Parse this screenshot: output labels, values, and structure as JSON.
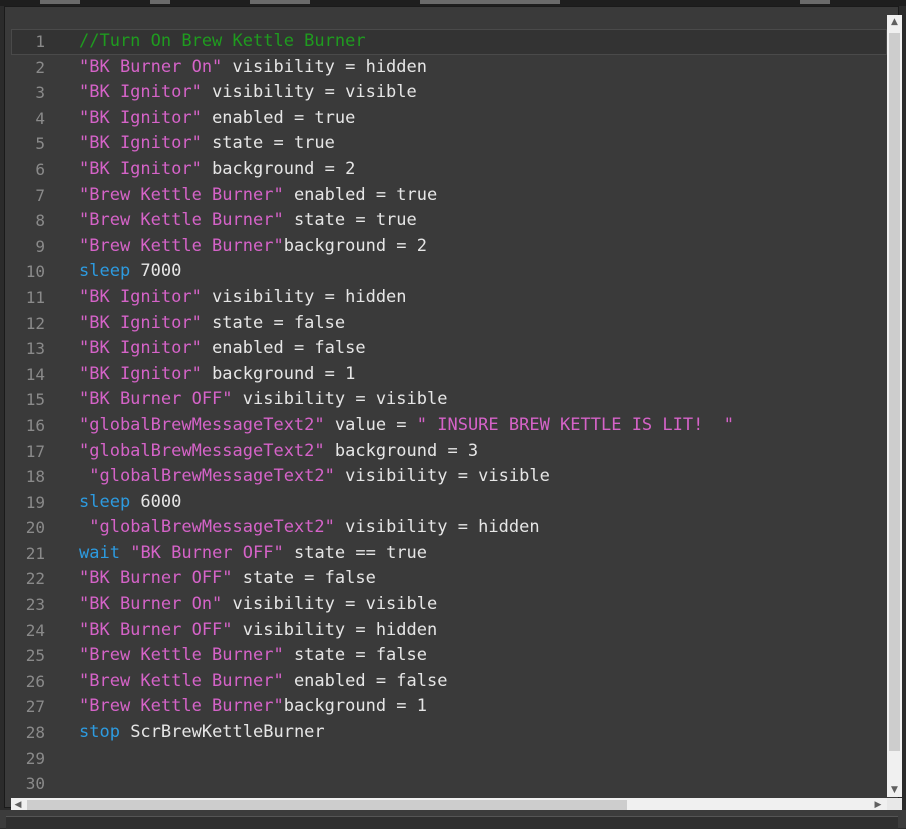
{
  "editor": {
    "lines": [
      {
        "n": "1",
        "tokens": [
          {
            "t": "cmt",
            "v": "//Turn On Brew Kettle Burner"
          }
        ]
      },
      {
        "n": "2",
        "tokens": [
          {
            "t": "str",
            "v": "\"BK Burner On\""
          },
          {
            "t": "txt",
            "v": " visibility = hidden"
          }
        ]
      },
      {
        "n": "3",
        "tokens": [
          {
            "t": "str",
            "v": "\"BK Ignitor\""
          },
          {
            "t": "txt",
            "v": " visibility = visible"
          }
        ]
      },
      {
        "n": "4",
        "tokens": [
          {
            "t": "str",
            "v": "\"BK Ignitor\""
          },
          {
            "t": "txt",
            "v": " enabled = true"
          }
        ]
      },
      {
        "n": "5",
        "tokens": [
          {
            "t": "str",
            "v": "\"BK Ignitor\""
          },
          {
            "t": "txt",
            "v": " state = true"
          }
        ]
      },
      {
        "n": "6",
        "tokens": [
          {
            "t": "str",
            "v": "\"BK Ignitor\""
          },
          {
            "t": "txt",
            "v": " background = 2"
          }
        ]
      },
      {
        "n": "7",
        "tokens": [
          {
            "t": "str",
            "v": "\"Brew Kettle Burner\""
          },
          {
            "t": "txt",
            "v": " enabled = true"
          }
        ]
      },
      {
        "n": "8",
        "tokens": [
          {
            "t": "str",
            "v": "\"Brew Kettle Burner\""
          },
          {
            "t": "txt",
            "v": " state = true"
          }
        ]
      },
      {
        "n": "9",
        "tokens": [
          {
            "t": "str",
            "v": "\"Brew Kettle Burner\""
          },
          {
            "t": "txt",
            "v": "background = 2"
          }
        ]
      },
      {
        "n": "10",
        "tokens": [
          {
            "t": "kw",
            "v": "sleep"
          },
          {
            "t": "txt",
            "v": " 7000"
          }
        ]
      },
      {
        "n": "11",
        "tokens": [
          {
            "t": "str",
            "v": "\"BK Ignitor\""
          },
          {
            "t": "txt",
            "v": " visibility = hidden"
          }
        ]
      },
      {
        "n": "12",
        "tokens": [
          {
            "t": "str",
            "v": "\"BK Ignitor\""
          },
          {
            "t": "txt",
            "v": " state = false"
          }
        ]
      },
      {
        "n": "13",
        "tokens": [
          {
            "t": "str",
            "v": "\"BK Ignitor\""
          },
          {
            "t": "txt",
            "v": " enabled = false"
          }
        ]
      },
      {
        "n": "14",
        "tokens": [
          {
            "t": "str",
            "v": "\"BK Ignitor\""
          },
          {
            "t": "txt",
            "v": " background = 1"
          }
        ]
      },
      {
        "n": "15",
        "tokens": [
          {
            "t": "str",
            "v": "\"BK Burner OFF\""
          },
          {
            "t": "txt",
            "v": " visibility = visible"
          }
        ]
      },
      {
        "n": "16",
        "tokens": [
          {
            "t": "str",
            "v": "\"globalBrewMessageText2\""
          },
          {
            "t": "txt",
            "v": " value = "
          },
          {
            "t": "str",
            "v": "\" INSURE BREW KETTLE IS LIT!  \""
          }
        ]
      },
      {
        "n": "17",
        "tokens": [
          {
            "t": "str",
            "v": "\"globalBrewMessageText2\""
          },
          {
            "t": "txt",
            "v": " background = 3"
          }
        ]
      },
      {
        "n": "18",
        "tokens": [
          {
            "t": "txt",
            "v": " "
          },
          {
            "t": "str",
            "v": "\"globalBrewMessageText2\""
          },
          {
            "t": "txt",
            "v": " visibility = visible"
          }
        ]
      },
      {
        "n": "19",
        "tokens": [
          {
            "t": "kw",
            "v": "sleep"
          },
          {
            "t": "txt",
            "v": " 6000"
          }
        ]
      },
      {
        "n": "20",
        "tokens": [
          {
            "t": "txt",
            "v": " "
          },
          {
            "t": "str",
            "v": "\"globalBrewMessageText2\""
          },
          {
            "t": "txt",
            "v": " visibility = hidden"
          }
        ]
      },
      {
        "n": "21",
        "tokens": [
          {
            "t": "kw",
            "v": "wait"
          },
          {
            "t": "txt",
            "v": " "
          },
          {
            "t": "str",
            "v": "\"BK Burner OFF\""
          },
          {
            "t": "txt",
            "v": " state == true"
          }
        ]
      },
      {
        "n": "22",
        "tokens": [
          {
            "t": "str",
            "v": "\"BK Burner OFF\""
          },
          {
            "t": "txt",
            "v": " state = false"
          }
        ]
      },
      {
        "n": "23",
        "tokens": [
          {
            "t": "str",
            "v": "\"BK Burner On\""
          },
          {
            "t": "txt",
            "v": " visibility = visible"
          }
        ]
      },
      {
        "n": "24",
        "tokens": [
          {
            "t": "str",
            "v": "\"BK Burner OFF\""
          },
          {
            "t": "txt",
            "v": " visibility = hidden"
          }
        ]
      },
      {
        "n": "25",
        "tokens": [
          {
            "t": "str",
            "v": "\"Brew Kettle Burner\""
          },
          {
            "t": "txt",
            "v": " state = false"
          }
        ]
      },
      {
        "n": "26",
        "tokens": [
          {
            "t": "str",
            "v": "\"Brew Kettle Burner\""
          },
          {
            "t": "txt",
            "v": " enabled = false"
          }
        ]
      },
      {
        "n": "27",
        "tokens": [
          {
            "t": "str",
            "v": "\"Brew Kettle Burner\""
          },
          {
            "t": "txt",
            "v": "background = 1"
          }
        ]
      },
      {
        "n": "28",
        "tokens": [
          {
            "t": "kw",
            "v": "stop"
          },
          {
            "t": "txt",
            "v": " ScrBrewKettleBurner"
          }
        ]
      },
      {
        "n": "29",
        "tokens": []
      },
      {
        "n": "30",
        "tokens": []
      }
    ],
    "current_line": "1"
  },
  "scrollbars": {
    "up_icon": "triangle-up-icon",
    "down_icon": "triangle-down-icon",
    "left_icon": "triangle-left-icon",
    "right_icon": "triangle-right-icon"
  },
  "colors": {
    "background": "#2b2b2b",
    "string": "#d563c8",
    "keyword": "#2d9be0",
    "comment": "#1f9b1f",
    "text": "#e6e6e6",
    "line_number": "#8a8a8a"
  }
}
